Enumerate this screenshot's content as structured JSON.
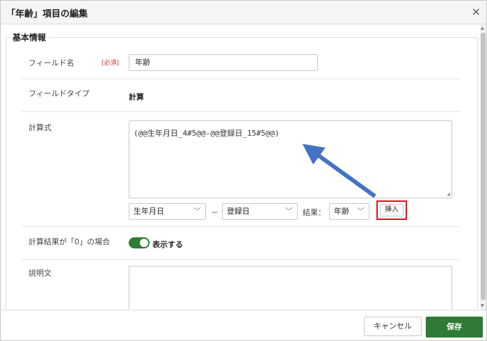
{
  "dialog": {
    "title": "「年齢」項目の編集",
    "close_icon": "×"
  },
  "section": {
    "title": "基本情報"
  },
  "fields": {
    "field_name": {
      "label": "フィールド名",
      "required": "[必須]",
      "value": "年齢"
    },
    "field_type": {
      "label": "フィールドタイプ",
      "value": "計算"
    },
    "formula": {
      "label": "計算式",
      "value": "(@@生年月日_4#5@@-@@登録日_15#5@@)",
      "select1": "生年月日",
      "operator": "－",
      "select2": "登録日",
      "result_label": "結果：",
      "result_select": "年齢",
      "insert_button": "挿入"
    },
    "zero_result": {
      "label": "計算結果が「0」の場合",
      "toggle_label": "表示する",
      "toggle_on": true
    },
    "description": {
      "label": "説明文",
      "value": ""
    }
  },
  "footer": {
    "cancel": "キャンセル",
    "save": "保存"
  },
  "colors": {
    "save": "#2f7a35",
    "toggle": "#2e7d32",
    "highlight": "#e0101a",
    "arrow": "#4472c4",
    "required": "#d03030"
  }
}
